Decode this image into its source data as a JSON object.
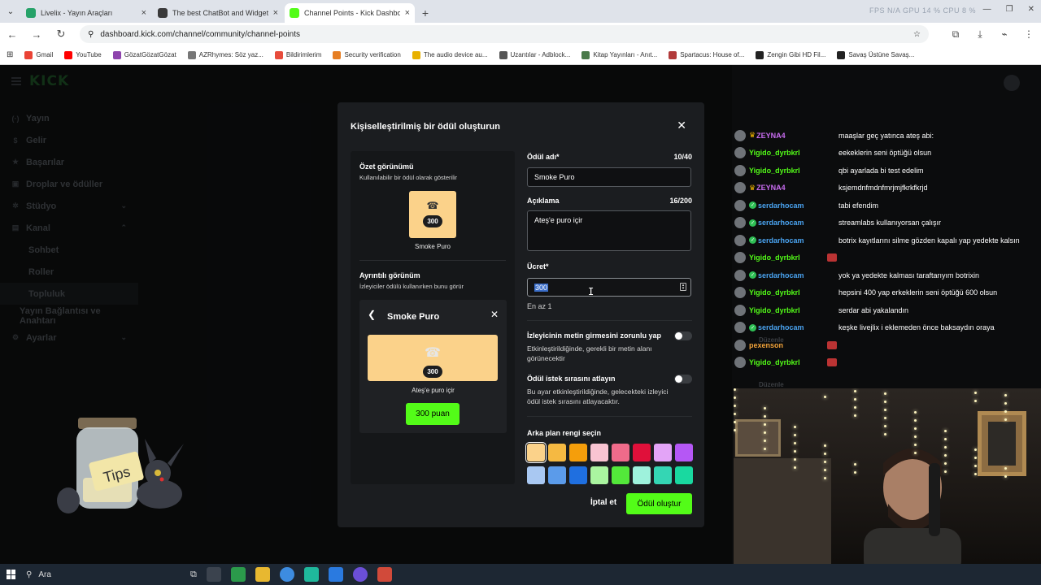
{
  "browser": {
    "tabs": [
      {
        "title": "Livelix - Yayın Araçları",
        "color": "#26a269"
      },
      {
        "title": "The best ChatBot and Widgets",
        "color": "#3a3a3a"
      },
      {
        "title": "Channel Points - Kick Dashboar",
        "color": "#53fc18"
      }
    ],
    "sysinfo": "FPS N/A   GPU 14 %   CPU 8 %",
    "url": "dashboard.kick.com/channel/community/channel-points",
    "bookmarks": [
      {
        "label": "Gmail",
        "color": "#ea4335"
      },
      {
        "label": "YouTube",
        "color": "#ff0000"
      },
      {
        "label": "GözatGözatGözat",
        "color": "#8e44ad"
      },
      {
        "label": "AZRhymes: Söz yaz...",
        "color": "#777777"
      },
      {
        "label": "Bildirimlerim",
        "color": "#e74c3c"
      },
      {
        "label": "Security verification",
        "color": "#e67e22"
      },
      {
        "label": "The audio device au...",
        "color": "#e8b100"
      },
      {
        "label": "Uzantılar - Adblock...",
        "color": "#555555"
      },
      {
        "label": "Kitap Yayınları - Anıt...",
        "color": "#4a7a4a"
      },
      {
        "label": "Spartacus: House of...",
        "color": "#b23b3b"
      },
      {
        "label": "Zengin Gibi HD Fil...",
        "color": "#222222"
      },
      {
        "label": "Savaş Üstüne Savaş...",
        "color": "#222222"
      }
    ]
  },
  "dashboard": {
    "logo": "KICK",
    "sidebar": [
      {
        "label": "Yayın",
        "icon": "(·)",
        "name": "sidebar-item-yayin"
      },
      {
        "label": "Gelir",
        "icon": "$",
        "name": "sidebar-item-gelir"
      },
      {
        "label": "Başarılar",
        "icon": "★",
        "name": "sidebar-item-basarilar"
      },
      {
        "label": "Droplar ve ödüller",
        "icon": "▣",
        "name": "sidebar-item-droplar"
      },
      {
        "label": "Stüdyo",
        "icon": "✲",
        "name": "sidebar-item-studyo",
        "chevron": "⌄"
      },
      {
        "label": "Kanal",
        "icon": "▤",
        "name": "sidebar-item-kanal",
        "chevron": "⌃"
      },
      {
        "label": "Sohbet",
        "name": "sidebar-item-sohbet",
        "sub": true
      },
      {
        "label": "Roller",
        "name": "sidebar-item-roller",
        "sub": true
      },
      {
        "label": "Topluluk",
        "name": "sidebar-item-topluluk",
        "sub": true,
        "selected": true
      },
      {
        "label": "Yayın Bağlantısı ve Anahtarı",
        "name": "sidebar-item-yayin-baglantisi",
        "extra": true
      },
      {
        "label": "Ayarlar",
        "icon": "⚙",
        "name": "sidebar-item-ayarlar",
        "chevron": "⌄"
      }
    ]
  },
  "modal": {
    "title": "Kişiselleştirilmiş bir ödül oluşturun",
    "summary_title": "Özet görünümü",
    "summary_sub": "Kullanılabilir bir ödül olarak gösterilir",
    "detail_title": "Ayrıntılı görünüm",
    "detail_sub": "İzleyiciler ödülü kullanırken bunu görür",
    "reward_name": "Smoke Puro",
    "reward_cost": "300",
    "reward_desc": "Ateş'e puro içir",
    "points_button": "300 puan",
    "card_color": "#fbd28a",
    "form": {
      "name_label": "Ödül adı*",
      "name_count": "10/40",
      "name_value": "Smoke Puro",
      "desc_label": "Açıklama",
      "desc_count": "16/200",
      "desc_value": "Ateş'e puro içir",
      "cost_label": "Ücret*",
      "cost_value": "300",
      "cost_hint": "En az 1",
      "toggle1_title": "İzleyicinin metin girmesini zorunlu yap",
      "toggle1_desc": "Etkinleştirildiğinde, gerekli bir metin alanı görünecektir",
      "toggle2_title": "Ödül istek sırasını atlayın",
      "toggle2_desc": "Bu ayar etkinleştirildiğinde, gelecekteki izleyici ödül istek sırasını atlayacaktır.",
      "color_label": "Arka plan rengi seçin",
      "colors": [
        "#fbd28a",
        "#f5b942",
        "#f59e0b",
        "#f9c4d2",
        "#f06b8a",
        "#e0103a",
        "#e3a4f7",
        "#b557f5",
        "#a9c8f2",
        "#5b9bea",
        "#1f6fe0",
        "#aaf5a0",
        "#53e83a",
        "#9ef2dc",
        "#34d6b4",
        "#19d9a0"
      ]
    },
    "cancel_label": "İptal et",
    "create_label": "Ödül oluştur"
  },
  "chat": [
    {
      "user": "ZEYNA4",
      "color": "#c86cf0",
      "crown": true,
      "text": "maaşlar geç yatınca ateş abi:"
    },
    {
      "user": "Yigido_dyrbkrl",
      "color": "#53fc18",
      "text": "eekeklerin seni öptüğü olsun"
    },
    {
      "user": "Yigido_dyrbkrl",
      "color": "#53fc18",
      "text": "qbi ayarlada bi test edelim"
    },
    {
      "user": "ZEYNA4",
      "color": "#c86cf0",
      "crown": true,
      "text": "ksjemdnfmdnfmrjmjfkrkfkrjd"
    },
    {
      "user": "serdarhocam",
      "color": "#4aa3f0",
      "badge": true,
      "text": "tabi efendim"
    },
    {
      "user": "serdarhocam",
      "color": "#4aa3f0",
      "badge": true,
      "text": "streamlabs kullanıyorsan çalışır"
    },
    {
      "user": "serdarhocam",
      "color": "#4aa3f0",
      "badge": true,
      "text": "botrix kayıtlarını silme gözden kapalı yap yedekte kalsın"
    },
    {
      "user": "Yigido_dyrbkrl",
      "color": "#53fc18",
      "text": ""
    },
    {
      "user": "serdarhocam",
      "color": "#4aa3f0",
      "badge": true,
      "text": "yok ya yedekte kalması taraftarıyım botrixin"
    },
    {
      "user": "Yigido_dyrbkrl",
      "color": "#53fc18",
      "text": "hepsini 400 yap erkeklerin seni öptüğü 600 olsun"
    },
    {
      "user": "Yigido_dyrbkrl",
      "color": "#53fc18",
      "text": "serdar abi yakalandın"
    },
    {
      "user": "serdarhocam",
      "color": "#4aa3f0",
      "badge": true,
      "text": "keşke livejlix i eklemeden önce baksaydın oraya"
    },
    {
      "user": "pexenson",
      "color": "#f2a33a",
      "text": ""
    },
    {
      "user": "Yigido_dyrbkrl",
      "color": "#53fc18",
      "text": ""
    }
  ],
  "ghost_text": {
    "edit1": "Düzenle",
    "edit2": "Düzenle"
  },
  "tipjar": {
    "label": "Tips"
  },
  "taskbar": {
    "search": "Ara"
  }
}
